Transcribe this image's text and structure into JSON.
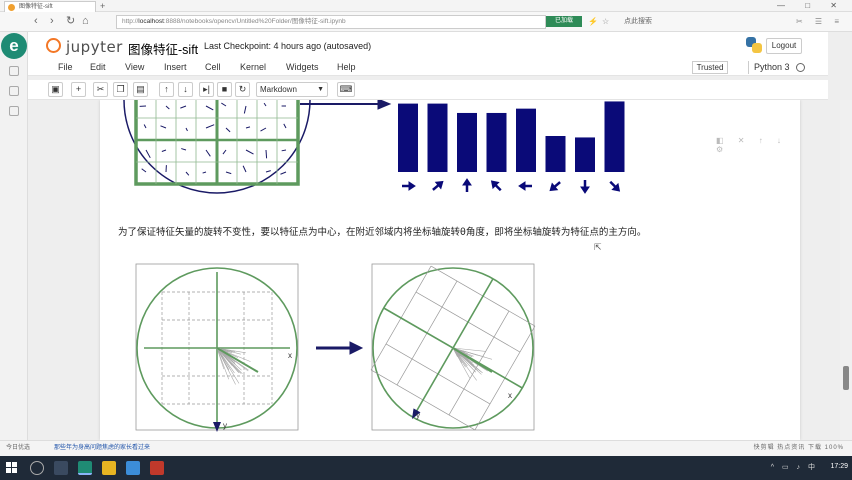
{
  "browser": {
    "tab_title": "图像特征-sift",
    "new_tab": "+",
    "window_controls": "— □ ✕",
    "url_prefix": "http://",
    "url_host": "localhost",
    "url_rest": ":8888/notebooks/opencv/Untitled%20Folder/图像特征-sift.ipynb",
    "badge": "已加载",
    "search_text": "点此搜索",
    "status_left": "今日优选",
    "status_message": "那些年为身高问题焦虑的家长看过来",
    "status_right": "快剪辑 热点资讯 下载 100%"
  },
  "jupyter": {
    "logo_text": "jupyter",
    "notebook_name": "图像特征-sift",
    "checkpoint": "Last Checkpoint: 4 hours ago (autosaved)",
    "logout": "Logout",
    "menu": [
      "File",
      "Edit",
      "View",
      "Insert",
      "Cell",
      "Kernel",
      "Widgets",
      "Help"
    ],
    "trusted": "Trusted",
    "kernel": "Python 3",
    "cell_type": "Markdown"
  },
  "notebook": {
    "paragraph": "为了保证特征矢量的旋转不变性，要以特征点为中心，在附近邻域内将坐标轴旋转θ角度，即将坐标轴旋转为特征点的主方向。",
    "axis_x": "x",
    "axis_y": "y",
    "histogram_bars": [
      0.95,
      0.95,
      0.82,
      0.82,
      0.88,
      0.5,
      0.48,
      0.98
    ]
  },
  "taskbar": {
    "clock": "17:29"
  },
  "colors": {
    "accent_orange": "#f37726",
    "bar_navy": "#0a0a78",
    "grid_green": "#5e9a5e",
    "sidebar_green": "#1f8b74"
  }
}
